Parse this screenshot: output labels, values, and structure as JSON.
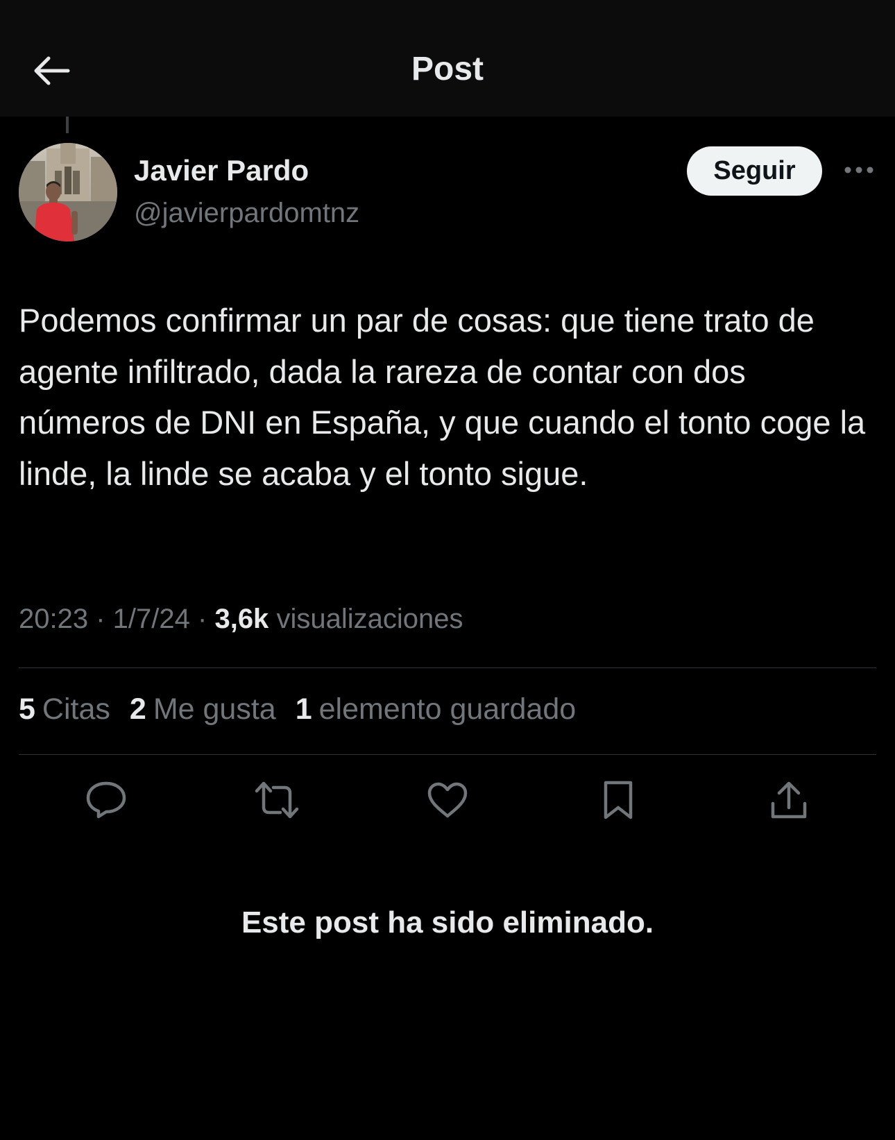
{
  "header": {
    "title": "Post",
    "back_icon": "arrow-left-icon"
  },
  "author": {
    "display_name": "Javier Pardo",
    "handle": "@javierpardomtnz",
    "avatar": "avatar-photo",
    "follow_label": "Seguir",
    "more_icon": "more-horizontal-icon"
  },
  "post": {
    "text": "Podemos confirmar un par de cosas: que tiene trato de agente infiltrado, dada la rareza de contar con dos números de DNI en España, y que cuando el tonto coge la linde, la linde se acaba y el tonto sigue.",
    "time": "20:23",
    "date": "1/7/24",
    "views_count": "3,6k",
    "views_label": "visualizaciones"
  },
  "stats": {
    "quotes_count": "5",
    "quotes_label": "Citas",
    "likes_count": "2",
    "likes_label": "Me gusta",
    "bookmarks_count": "1",
    "bookmarks_label": "elemento guardado"
  },
  "actions": [
    "reply-icon",
    "repost-icon",
    "like-icon",
    "bookmark-icon",
    "share-icon"
  ],
  "notice": {
    "deleted_text": "Este post ha sido eliminado."
  },
  "colors": {
    "background": "#000000",
    "header_background": "#0c0c0c",
    "text_primary": "#e7e9ea",
    "text_secondary": "#71767b",
    "divider": "#2f3336",
    "follow_button_bg": "#eff3f4"
  }
}
